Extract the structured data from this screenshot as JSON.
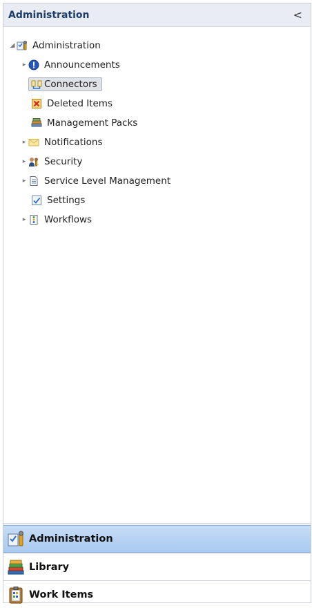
{
  "header": {
    "title": "Administration",
    "collapse_glyph": "<"
  },
  "tree": {
    "root": {
      "label": "Administration",
      "icon": "administration-icon",
      "expanded": true
    },
    "items": [
      {
        "label": "Announcements",
        "icon": "info-circle-icon",
        "has_children": true
      },
      {
        "label": "Connectors",
        "icon": "connectors-icon",
        "has_children": false,
        "selected": true
      },
      {
        "label": "Deleted Items",
        "icon": "deleted-items-icon",
        "has_children": false
      },
      {
        "label": "Management Packs",
        "icon": "management-packs-icon",
        "has_children": false
      },
      {
        "label": "Notifications",
        "icon": "envelope-icon",
        "has_children": true
      },
      {
        "label": "Security",
        "icon": "users-key-icon",
        "has_children": true
      },
      {
        "label": "Service Level Management",
        "icon": "document-icon",
        "has_children": true
      },
      {
        "label": "Settings",
        "icon": "checkbox-icon",
        "has_children": false
      },
      {
        "label": "Workflows",
        "icon": "workflow-icon",
        "has_children": true
      }
    ]
  },
  "splitter": {
    "grip": "........."
  },
  "wunderbar": [
    {
      "label": "Administration",
      "icon": "administration-icon",
      "active": true
    },
    {
      "label": "Library",
      "icon": "books-icon",
      "active": false
    },
    {
      "label": "Work Items",
      "icon": "clipboard-icon",
      "active": false
    }
  ],
  "colors": {
    "header_bg": "#e9edf3",
    "active_nav": "#b7d3f3",
    "selected_item": "#dfe3e8"
  }
}
